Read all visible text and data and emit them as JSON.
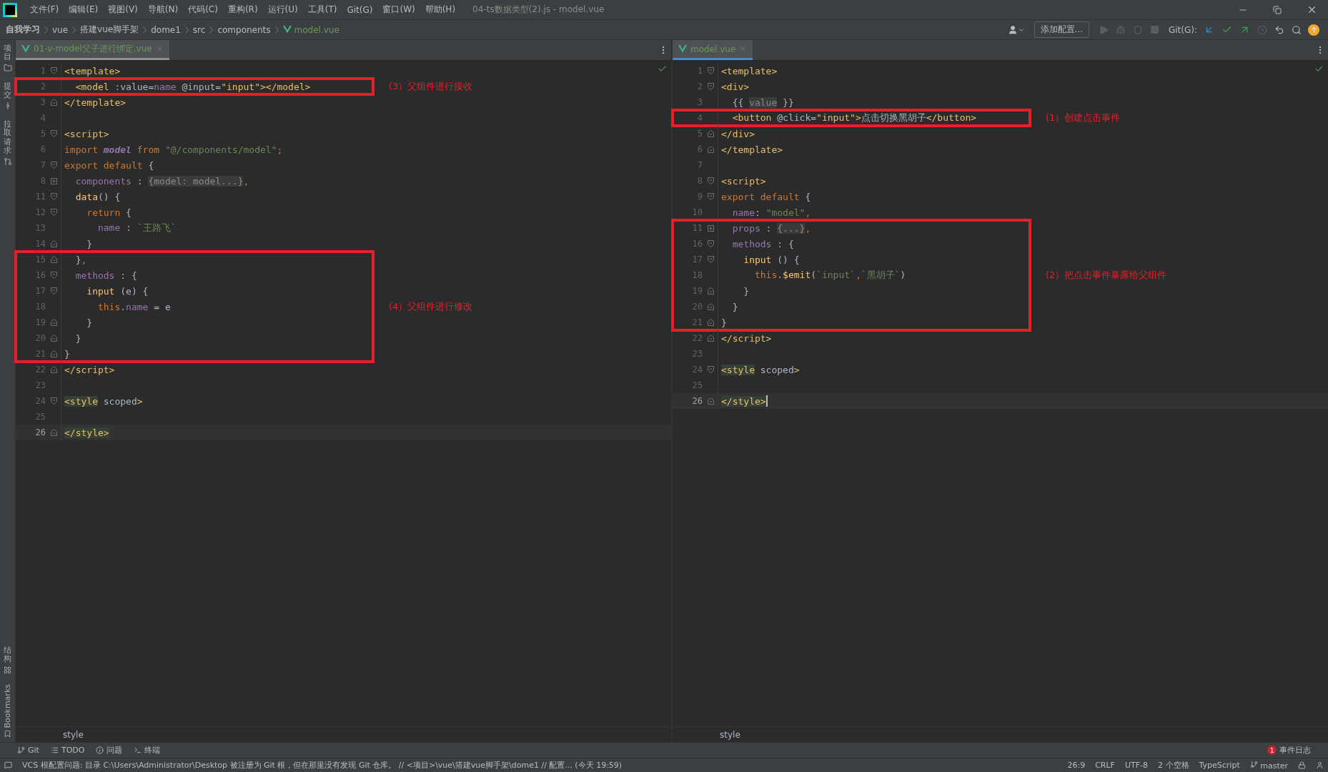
{
  "title_bar": {
    "menus": [
      "文件(F)",
      "编辑(E)",
      "视图(V)",
      "导航(N)",
      "代码(C)",
      "重构(R)",
      "运行(U)",
      "工具(T)",
      "Git(G)",
      "窗口(W)",
      "帮助(H)"
    ],
    "title": "04-ts数据类型(2).js - model.vue"
  },
  "nav_bar": {
    "breadcrumb": [
      {
        "label": "自我学习",
        "kind": "project"
      },
      {
        "label": "vue",
        "kind": "folder"
      },
      {
        "label": "搭建vue脚手架",
        "kind": "folder"
      },
      {
        "label": "dome1",
        "kind": "folder"
      },
      {
        "label": "src",
        "kind": "folder"
      },
      {
        "label": "components",
        "kind": "folder"
      },
      {
        "label": "model.vue",
        "kind": "file"
      }
    ],
    "run_config": "添加配置...",
    "git_label": "Git(G):"
  },
  "tool_strip": {
    "top": [
      "项目",
      "提交",
      "拉取请求"
    ],
    "bottom": [
      "结构",
      "Bookmarks"
    ]
  },
  "editors": [
    {
      "focused": false,
      "tab": {
        "label": "01-v-model父子进行绑定.vue",
        "selected": true
      },
      "footer": "style",
      "blocks": [
        {
          "kind": "plain",
          "lines": [
            {
              "num": "1",
              "kind": "fold-start",
              "current": false,
              "tokens": [
                {
                  "kind": "tag",
                  "text": "<template>"
                }
              ]
            }
          ]
        },
        {
          "kind": "annotated",
          "note": "(3）父组件进行接收",
          "lines": [
            {
              "num": "2",
              "kind": "plain",
              "current": false,
              "tokens": [
                {
                  "kind": "tag",
                  "text": "  <model"
                },
                {
                  "kind": "plain",
                  "text": " :value="
                },
                {
                  "kind": "prop",
                  "text": "name"
                },
                {
                  "kind": "plain",
                  "text": " @input="
                },
                {
                  "kind": "tag",
                  "text": "\"input\""
                },
                {
                  "kind": "tag",
                  "text": "></model>"
                }
              ]
            }
          ]
        },
        {
          "kind": "plain",
          "lines": [
            {
              "num": "3",
              "kind": "fold-end",
              "current": false,
              "tokens": [
                {
                  "kind": "tag",
                  "text": "</template>"
                }
              ]
            },
            {
              "num": "4",
              "kind": "plain",
              "current": false
            },
            {
              "num": "5",
              "kind": "fold-start",
              "current": false,
              "tokens": [
                {
                  "kind": "tag",
                  "text": "<script>"
                }
              ]
            },
            {
              "num": "6",
              "kind": "plain",
              "current": false,
              "tokens": [
                {
                  "kind": "keyword",
                  "text": "import "
                },
                {
                  "kind": "name",
                  "text": "model"
                },
                {
                  "kind": "keyword",
                  "text": " from "
                },
                {
                  "kind": "string",
                  "text": "\"@/components/model\""
                },
                {
                  "kind": "keyword",
                  "text": ";"
                }
              ]
            },
            {
              "num": "7",
              "kind": "fold-start",
              "current": false,
              "tokens": [
                {
                  "kind": "keyword",
                  "text": "export default "
                },
                {
                  "kind": "plain",
                  "text": "{"
                }
              ]
            },
            {
              "num": "8",
              "kind": "collapsed",
              "current": false,
              "tokens": [
                {
                  "kind": "prop",
                  "text": "  components"
                },
                {
                  "kind": "plain",
                  "text": " : "
                },
                {
                  "kind": "folded",
                  "text": "{model: model...}"
                },
                {
                  "kind": "keyword",
                  "text": ","
                }
              ]
            },
            {
              "num": "11",
              "kind": "fold-start",
              "current": false,
              "tokens": [
                {
                  "kind": "func",
                  "text": "  data"
                },
                {
                  "kind": "plain",
                  "text": "() {"
                }
              ]
            },
            {
              "num": "12",
              "kind": "fold-start",
              "current": false,
              "tokens": [
                {
                  "kind": "keyword",
                  "text": "    return "
                },
                {
                  "kind": "plain",
                  "text": "{"
                }
              ]
            },
            {
              "num": "13",
              "kind": "plain",
              "current": false,
              "tokens": [
                {
                  "kind": "prop",
                  "text": "      name"
                },
                {
                  "kind": "plain",
                  "text": " : "
                },
                {
                  "kind": "string",
                  "text": "`王路飞`"
                }
              ]
            },
            {
              "num": "14",
              "kind": "fold-end",
              "current": false,
              "tokens": [
                {
                  "kind": "plain",
                  "text": "    }"
                }
              ]
            }
          ]
        },
        {
          "kind": "annotated",
          "note": "(4）父组件进行修改",
          "lines": [
            {
              "num": "15",
              "kind": "fold-end",
              "current": false,
              "tokens": [
                {
                  "kind": "plain",
                  "text": "  }"
                },
                {
                  "kind": "keyword",
                  "text": ","
                }
              ]
            },
            {
              "num": "16",
              "kind": "fold-start",
              "current": false,
              "tokens": [
                {
                  "kind": "prop",
                  "text": "  methods"
                },
                {
                  "kind": "plain",
                  "text": " : {"
                }
              ]
            },
            {
              "num": "17",
              "kind": "fold-start",
              "current": false,
              "tokens": [
                {
                  "kind": "func",
                  "text": "    input"
                },
                {
                  "kind": "plain",
                  "text": " (e) {"
                }
              ]
            },
            {
              "num": "18",
              "kind": "plain",
              "current": false,
              "tokens": [
                {
                  "kind": "keyword",
                  "text": "      this"
                },
                {
                  "kind": "plain",
                  "text": "."
                },
                {
                  "kind": "prop",
                  "text": "name"
                },
                {
                  "kind": "plain",
                  "text": " = e"
                }
              ]
            },
            {
              "num": "19",
              "kind": "fold-end",
              "current": false,
              "tokens": [
                {
                  "kind": "plain",
                  "text": "    }"
                }
              ]
            },
            {
              "num": "20",
              "kind": "fold-end",
              "current": false,
              "tokens": [
                {
                  "kind": "plain",
                  "text": "  }"
                }
              ]
            },
            {
              "num": "21",
              "kind": "fold-end",
              "current": false,
              "tokens": [
                {
                  "kind": "plain",
                  "text": "}"
                }
              ]
            }
          ]
        },
        {
          "kind": "plain",
          "lines": [
            {
              "num": "22",
              "kind": "fold-end",
              "current": false,
              "tokens": [
                {
                  "kind": "tag",
                  "text": "</script>"
                }
              ]
            },
            {
              "num": "23",
              "kind": "plain",
              "current": false
            },
            {
              "num": "24",
              "kind": "fold-start",
              "current": false,
              "tokens": [
                {
                  "kind": "tagmatch",
                  "text": "<style"
                },
                {
                  "kind": "plain",
                  "text": " scoped"
                },
                {
                  "kind": "tag",
                  "text": ">"
                }
              ]
            },
            {
              "num": "25",
              "kind": "plain",
              "current": false
            },
            {
              "num": "26",
              "kind": "fold-end",
              "current": true,
              "tokens": [
                {
                  "kind": "tagmatch",
                  "text": "</style>"
                }
              ]
            }
          ]
        }
      ]
    },
    {
      "focused": true,
      "tab": {
        "label": "model.vue",
        "selected": true
      },
      "footer": "style",
      "blocks": [
        {
          "kind": "plain",
          "lines": [
            {
              "num": "1",
              "kind": "fold-start",
              "current": false,
              "tokens": [
                {
                  "kind": "tag",
                  "text": "<template>"
                }
              ]
            },
            {
              "num": "2",
              "kind": "fold-start",
              "current": false,
              "tokens": [
                {
                  "kind": "tag",
                  "text": "<div>"
                }
              ]
            },
            {
              "num": "3",
              "kind": "plain",
              "current": false,
              "tokens": [
                {
                  "kind": "plain",
                  "text": "  {{ "
                },
                {
                  "kind": "match",
                  "text": "value"
                },
                {
                  "kind": "plain",
                  "text": " }}"
                }
              ]
            }
          ]
        },
        {
          "kind": "annotated",
          "note": "(1）创建点击事件",
          "lines": [
            {
              "num": "4",
              "kind": "plain",
              "current": false,
              "tokens": [
                {
                  "kind": "tag",
                  "text": "  <button"
                },
                {
                  "kind": "plain",
                  "text": " @click="
                },
                {
                  "kind": "tag",
                  "text": "\"input\""
                },
                {
                  "kind": "tag",
                  "text": ">"
                },
                {
                  "kind": "plain",
                  "text": "点击切换黑胡子"
                },
                {
                  "kind": "tag",
                  "text": "</button>"
                }
              ]
            }
          ]
        },
        {
          "kind": "plain",
          "lines": [
            {
              "num": "5",
              "kind": "fold-end",
              "current": false,
              "tokens": [
                {
                  "kind": "tag",
                  "text": "</div>"
                }
              ]
            },
            {
              "num": "6",
              "kind": "fold-end",
              "current": false,
              "tokens": [
                {
                  "kind": "tag",
                  "text": "</template>"
                }
              ]
            },
            {
              "num": "7",
              "kind": "plain",
              "current": false
            },
            {
              "num": "8",
              "kind": "fold-start",
              "current": false,
              "tokens": [
                {
                  "kind": "tag",
                  "text": "<script>"
                }
              ]
            },
            {
              "num": "9",
              "kind": "fold-start",
              "current": false,
              "tokens": [
                {
                  "kind": "keyword",
                  "text": "export default "
                },
                {
                  "kind": "plain",
                  "text": "{"
                }
              ]
            },
            {
              "num": "10",
              "kind": "plain",
              "current": false,
              "tokens": [
                {
                  "kind": "prop",
                  "text": "  name"
                },
                {
                  "kind": "plain",
                  "text": ": "
                },
                {
                  "kind": "string",
                  "text": "\"model\""
                },
                {
                  "kind": "keyword",
                  "text": ","
                }
              ]
            }
          ]
        },
        {
          "kind": "annotated",
          "note": "(2）把点击事件暴露给父组件",
          "lines": [
            {
              "num": "11",
              "kind": "collapsed",
              "current": false,
              "tokens": [
                {
                  "kind": "prop",
                  "text": "  props"
                },
                {
                  "kind": "plain",
                  "text": " : "
                },
                {
                  "kind": "folded",
                  "text": "{...}"
                },
                {
                  "kind": "keyword",
                  "text": ","
                }
              ]
            },
            {
              "num": "16",
              "kind": "fold-start",
              "current": false,
              "tokens": [
                {
                  "kind": "prop",
                  "text": "  methods"
                },
                {
                  "kind": "plain",
                  "text": " : {"
                }
              ]
            },
            {
              "num": "17",
              "kind": "fold-start",
              "current": false,
              "tokens": [
                {
                  "kind": "func",
                  "text": "    input"
                },
                {
                  "kind": "plain",
                  "text": " () {"
                }
              ]
            },
            {
              "num": "18",
              "kind": "plain",
              "current": false,
              "tokens": [
                {
                  "kind": "keyword",
                  "text": "      this"
                },
                {
                  "kind": "plain",
                  "text": "."
                },
                {
                  "kind": "func",
                  "text": "$emit"
                },
                {
                  "kind": "plain",
                  "text": "("
                },
                {
                  "kind": "string",
                  "text": "`input`"
                },
                {
                  "kind": "keyword",
                  "text": ","
                },
                {
                  "kind": "string",
                  "text": "`黑胡子`"
                },
                {
                  "kind": "plain",
                  "text": ")"
                }
              ]
            },
            {
              "num": "19",
              "kind": "fold-end",
              "current": false,
              "tokens": [
                {
                  "kind": "plain",
                  "text": "    }"
                }
              ]
            },
            {
              "num": "20",
              "kind": "fold-end",
              "current": false,
              "tokens": [
                {
                  "kind": "plain",
                  "text": "  }"
                }
              ]
            },
            {
              "num": "21",
              "kind": "fold-end",
              "current": false,
              "tokens": [
                {
                  "kind": "plain",
                  "text": "}"
                }
              ]
            }
          ]
        },
        {
          "kind": "plain",
          "lines": [
            {
              "num": "22",
              "kind": "fold-end",
              "current": false,
              "tokens": [
                {
                  "kind": "tag",
                  "text": "</script>"
                }
              ]
            },
            {
              "num": "23",
              "kind": "plain",
              "current": false
            },
            {
              "num": "24",
              "kind": "fold-start",
              "current": false,
              "tokens": [
                {
                  "kind": "tagmatch",
                  "text": "<style"
                },
                {
                  "kind": "plain",
                  "text": " scoped"
                },
                {
                  "kind": "tag",
                  "text": ">"
                }
              ]
            },
            {
              "num": "25",
              "kind": "plain",
              "current": false
            },
            {
              "num": "26",
              "kind": "fold-end",
              "current": true,
              "tokens": [
                {
                  "kind": "tagmatch",
                  "text": "</style>"
                }
              ]
            }
          ]
        }
      ]
    }
  ],
  "tool_bar": {
    "items": [
      "Git",
      "TODO",
      "问题",
      "终端"
    ],
    "event_log": {
      "count": "1",
      "label": "事件日志"
    }
  },
  "status_bar": {
    "message": "VCS 根配置问题: 目录 C:\\Users\\Administrator\\Desktop 被注册为 Git 根，但在那里没有发现 Git 仓库。 // <项目>\\vue\\搭建vue脚手架\\dome1 // 配置... (今天 19:59)",
    "items": [
      "26:9",
      "CRLF",
      "UTF-8",
      "2 个空格",
      "TypeScript"
    ],
    "branch": "master"
  }
}
